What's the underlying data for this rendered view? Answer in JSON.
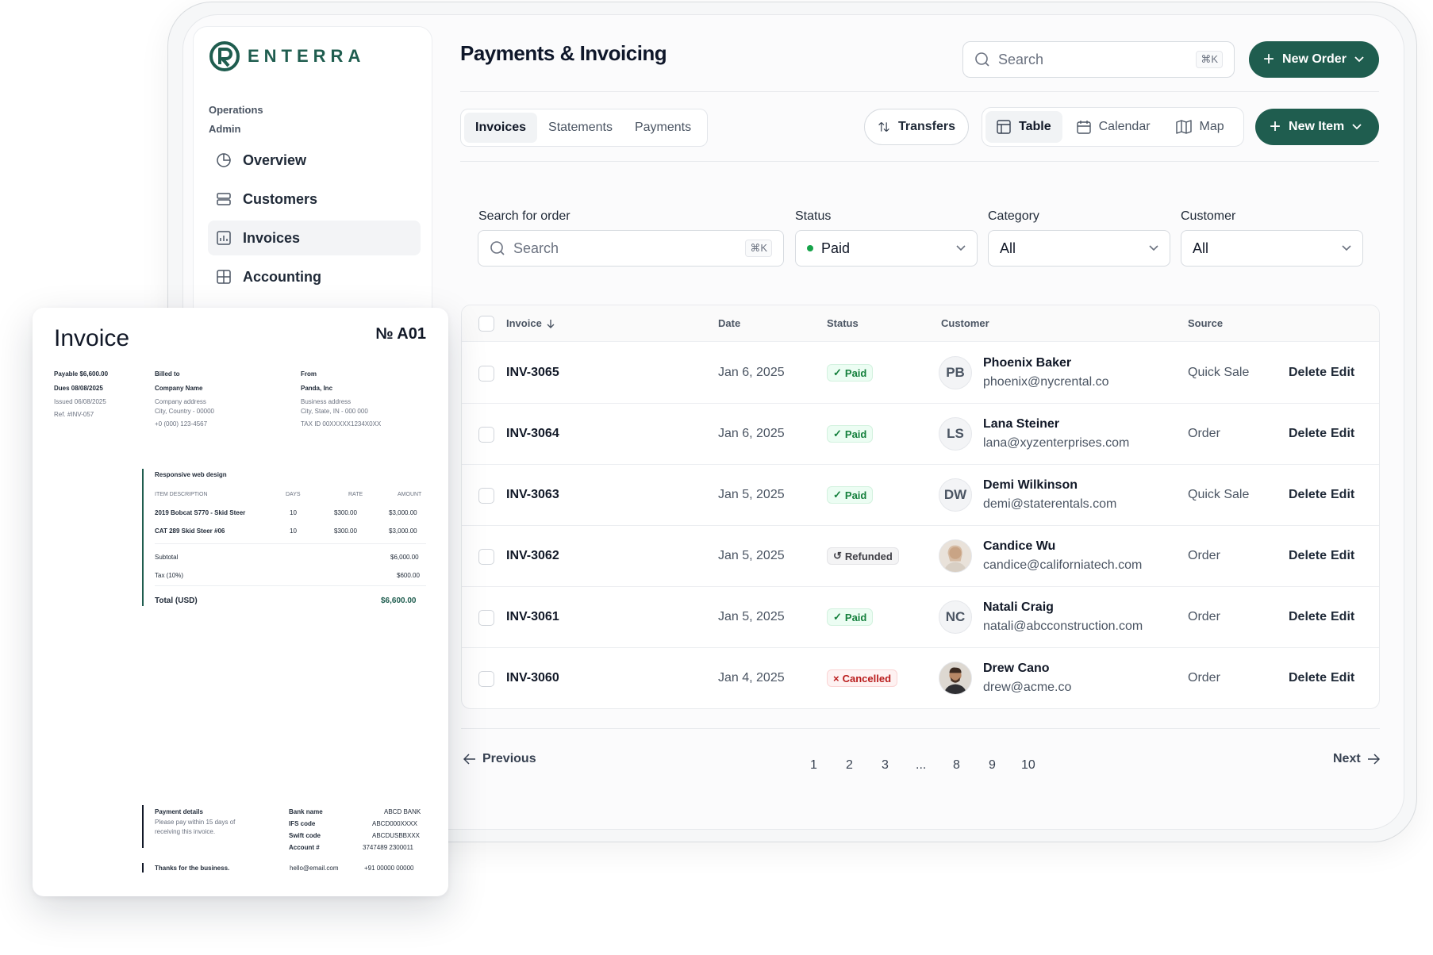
{
  "brand": {
    "name": "ENTERRA",
    "color": "#1f5d4f"
  },
  "sidebar": {
    "section_1": "Operations",
    "section_2": "Admin",
    "items": [
      {
        "label": "Overview",
        "icon": "pie-chart-icon"
      },
      {
        "label": "Customers",
        "icon": "server-stack-icon"
      },
      {
        "label": "Invoices",
        "icon": "bar-chart-icon",
        "active": true
      },
      {
        "label": "Accounting",
        "icon": "grid-icon"
      }
    ]
  },
  "header": {
    "title": "Payments & Invoicing",
    "search_placeholder": "Search",
    "search_shortcut": "⌘K",
    "new_order_label": "New Order"
  },
  "toolbar": {
    "tabs": [
      "Invoices",
      "Statements",
      "Payments"
    ],
    "active_tab": "Invoices",
    "transfers_label": "Transfers",
    "views": [
      "Table",
      "Calendar",
      "Map"
    ],
    "active_view": "Table",
    "new_item_label": "New Item"
  },
  "filters": {
    "search_label": "Search for order",
    "search_placeholder": "Search",
    "search_shortcut": "⌘K",
    "status_label": "Status",
    "status_value": "Paid",
    "category_label": "Category",
    "category_value": "All",
    "customer_label": "Customer",
    "customer_value": "All"
  },
  "table": {
    "columns": [
      "Invoice",
      "Date",
      "Status",
      "Customer",
      "Source"
    ],
    "rows": [
      {
        "invoice": "INV-3065",
        "date": "Jan 6, 2025",
        "status": "Paid",
        "initials": "PB",
        "name": "Phoenix Baker",
        "email": "phoenix@nycrental.co",
        "source": "Quick Sale"
      },
      {
        "invoice": "INV-3064",
        "date": "Jan 6, 2025",
        "status": "Paid",
        "initials": "LS",
        "name": "Lana Steiner",
        "email": "lana@xyzenterprises.com",
        "source": "Order"
      },
      {
        "invoice": "INV-3063",
        "date": "Jan 5, 2025",
        "status": "Paid",
        "initials": "DW",
        "name": "Demi Wilkinson",
        "email": "demi@staterentals.com",
        "source": "Quick Sale"
      },
      {
        "invoice": "INV-3062",
        "date": "Jan 5, 2025",
        "status": "Refunded",
        "initials": "",
        "name": "Candice Wu",
        "email": "candice@californiatech.com",
        "source": "Order"
      },
      {
        "invoice": "INV-3061",
        "date": "Jan 5, 2025",
        "status": "Paid",
        "initials": "NC",
        "name": "Natali Craig",
        "email": "natali@abcconstruction.com",
        "source": "Order"
      },
      {
        "invoice": "INV-3060",
        "date": "Jan 4, 2025",
        "status": "Cancelled",
        "initials": "",
        "name": "Drew Cano",
        "email": "drew@acme.co",
        "source": "Order"
      }
    ],
    "delete_label": "Delete",
    "edit_label": "Edit"
  },
  "pagination": {
    "previous": "Previous",
    "next": "Next",
    "pages": [
      "1",
      "2",
      "3",
      "...",
      "8",
      "9",
      "10"
    ]
  },
  "invoice_doc": {
    "title": "Invoice",
    "number": "№ A01",
    "payable": "Payable $6,600.00",
    "dues": "Dues 08/08/2025",
    "issued": "Issued 06/08/2025",
    "ref": "Ref. #INV-057",
    "billed_to_label": "Billed to",
    "billed_name": "Company Name",
    "billed_address": "Company address",
    "billed_city": "City, Country - 00000",
    "billed_phone": "+0 (000) 123-4567",
    "from_label": "From",
    "from_name": "Panda, Inc",
    "from_address": "Business address",
    "from_city": "City, State, IN - 000 000",
    "from_tax": "TAX ID 00XXXXX1234X0XX",
    "project": "Responsive web design",
    "item_headers": [
      "ITEM DESCRIPTION",
      "DAYS",
      "RATE",
      "AMOUNT"
    ],
    "items": [
      {
        "desc": "2019 Bobcat S770 - Skid Steer",
        "days": "10",
        "rate": "$300.00",
        "amount": "$3,000.00"
      },
      {
        "desc": "CAT 289 Skid Steer #06",
        "days": "10",
        "rate": "$300.00",
        "amount": "$3,000.00"
      }
    ],
    "subtotal_label": "Subtotal",
    "subtotal": "$6,000.00",
    "tax_label": "Tax (10%)",
    "tax": "$600.00",
    "total_label": "Total (USD)",
    "total": "$6,600.00",
    "payment_details_label": "Payment details",
    "payment_note_1": "Please pay within 15 days of",
    "payment_note_2": "receiving this invoice.",
    "bank": [
      {
        "label": "Bank name",
        "value": "ABCD BANK"
      },
      {
        "label": "IFS code",
        "value": "ABCD000XXXX"
      },
      {
        "label": "Swift code",
        "value": "ABCDUSBBXXX"
      },
      {
        "label": "Account #",
        "value": "3747489 2300011"
      }
    ],
    "thanks": "Thanks for the business.",
    "email": "hello@email.com",
    "phone": "+91 00000 00000"
  }
}
